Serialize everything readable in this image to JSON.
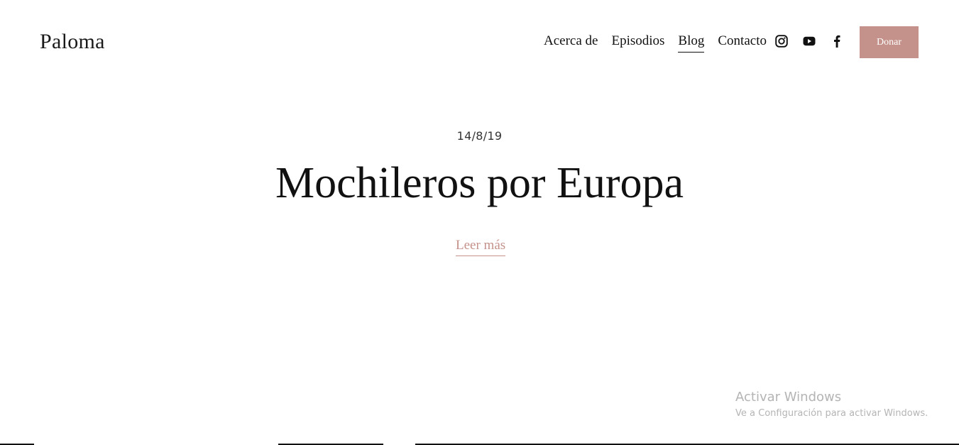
{
  "header": {
    "logo": "Paloma",
    "nav": [
      {
        "label": "Acerca de",
        "active": false
      },
      {
        "label": "Episodios",
        "active": false
      },
      {
        "label": "Blog",
        "active": true
      },
      {
        "label": "Contacto",
        "active": false
      }
    ],
    "social": [
      {
        "icon": "instagram-icon"
      },
      {
        "icon": "youtube-icon"
      },
      {
        "icon": "facebook-icon"
      }
    ],
    "donate_label": "Donar"
  },
  "post": {
    "date": "14/8/19",
    "title": "Mochileros por Europa",
    "read_more": "Leer más"
  },
  "watermark": {
    "title": "Activar Windows",
    "subtitle": "Ve a Configuración para activar Windows."
  },
  "colors": {
    "accent": "#c4928a",
    "text": "#111111",
    "background": "#ffffff",
    "watermark": "#b4b4b4"
  }
}
